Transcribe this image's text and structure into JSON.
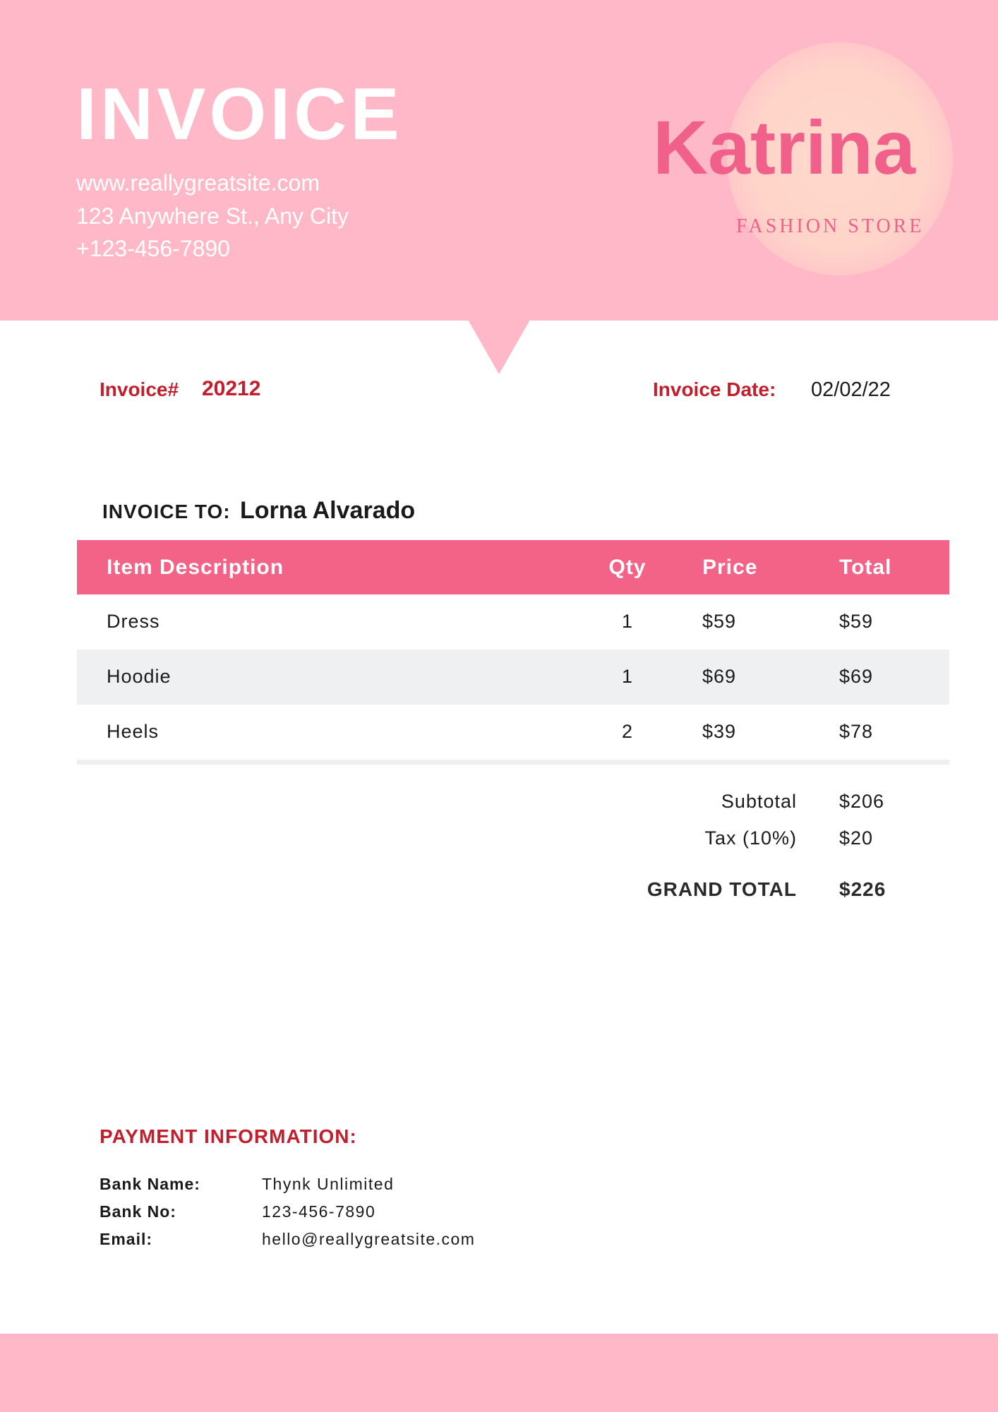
{
  "header": {
    "title": "INVOICE",
    "website": "www.reallygreatsite.com",
    "address": "123 Anywhere St., Any City",
    "phone": "+123-456-7890",
    "brand_name": "Katrina",
    "brand_tagline": "FASHION STORE"
  },
  "invoice": {
    "number_label": "Invoice#",
    "number": "20212",
    "date_label": "Invoice Date:",
    "date": "02/02/22"
  },
  "bill_to": {
    "label": "INVOICE TO:",
    "name": "Lorna Alvarado"
  },
  "table": {
    "headers": [
      "Item Description",
      "Qty",
      "Price",
      "Total"
    ],
    "rows": [
      {
        "description": "Dress",
        "qty": "1",
        "price": "$59",
        "total": "$59"
      },
      {
        "description": "Hoodie",
        "qty": "1",
        "price": "$69",
        "total": "$69"
      },
      {
        "description": "Heels",
        "qty": "2",
        "price": "$39",
        "total": "$78"
      }
    ]
  },
  "summary": {
    "subtotal_label": "Subtotal",
    "subtotal": "$206",
    "tax_label": "Tax (10%)",
    "tax": "$20",
    "grand_total_label": "GRAND TOTAL",
    "grand_total": "$226"
  },
  "payment": {
    "title": "PAYMENT INFORMATION:",
    "bank_name_label": "Bank Name:",
    "bank_name": "Thynk Unlimited",
    "bank_no_label": "Bank No:",
    "bank_no": "123-456-7890",
    "email_label": "Email:",
    "email": "hello@reallygreatsite.com"
  },
  "colors": {
    "header_pink": "#ffb8c8",
    "accent_pink": "#f26387",
    "label_red": "#c41e2c",
    "row_alt": "#eff0f2"
  }
}
